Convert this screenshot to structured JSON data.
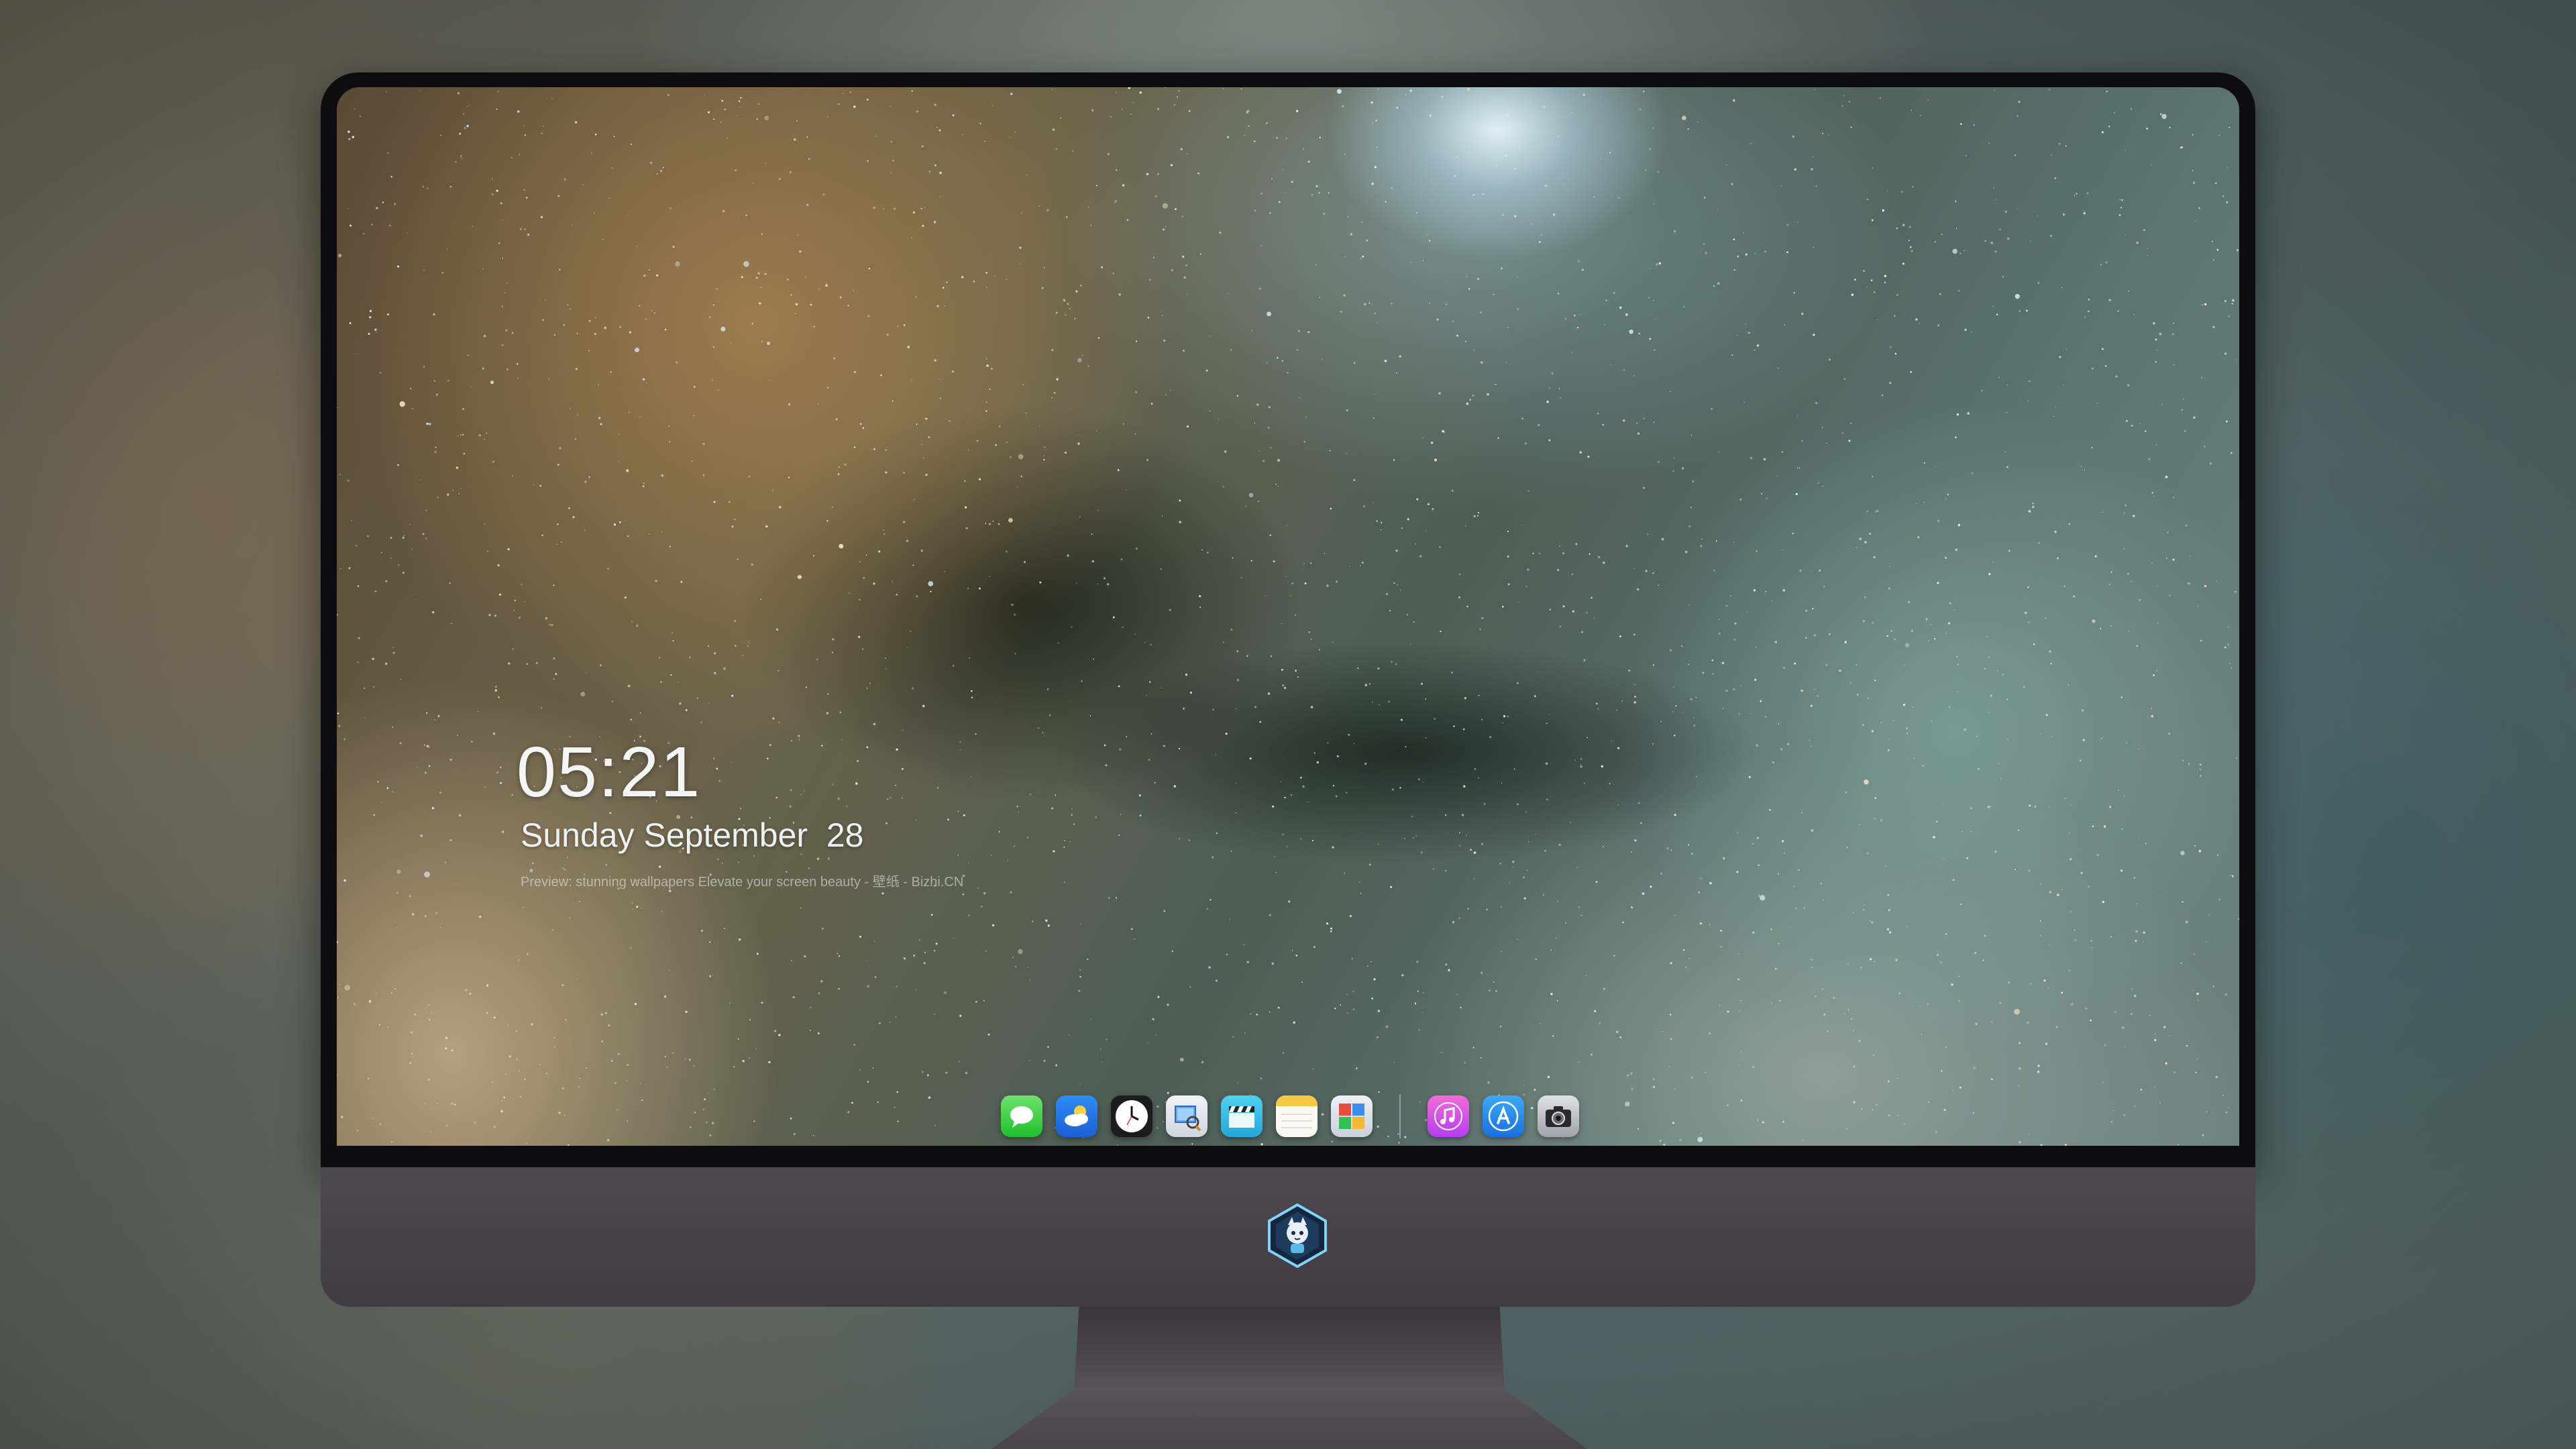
{
  "lock_screen": {
    "time": "05:21",
    "date": "Sunday September  28",
    "wallpaper_caption": "Preview: stunning wallpapers Elevate your screen beauty - 壁纸 - Bizhi.CN"
  },
  "dock": {
    "apps": [
      {
        "name": "Messages",
        "icon": "messages-icon"
      },
      {
        "name": "Weather",
        "icon": "weather-icon"
      },
      {
        "name": "Clock",
        "icon": "clock-icon"
      },
      {
        "name": "Preview",
        "icon": "preview-icon"
      },
      {
        "name": "Videos",
        "icon": "clapperboard-icon"
      },
      {
        "name": "Notes",
        "icon": "notes-icon"
      },
      {
        "name": "Photo Booth",
        "icon": "gallery-icon"
      },
      {
        "name": "Music",
        "icon": "music-icon"
      },
      {
        "name": "App Store",
        "icon": "app-store-icon"
      },
      {
        "name": "Camera",
        "icon": "camera-icon"
      }
    ]
  },
  "colors": {
    "bezel": "#0d0d0f",
    "chin": "#4a424b",
    "clock_text": "#f4f6f6"
  }
}
